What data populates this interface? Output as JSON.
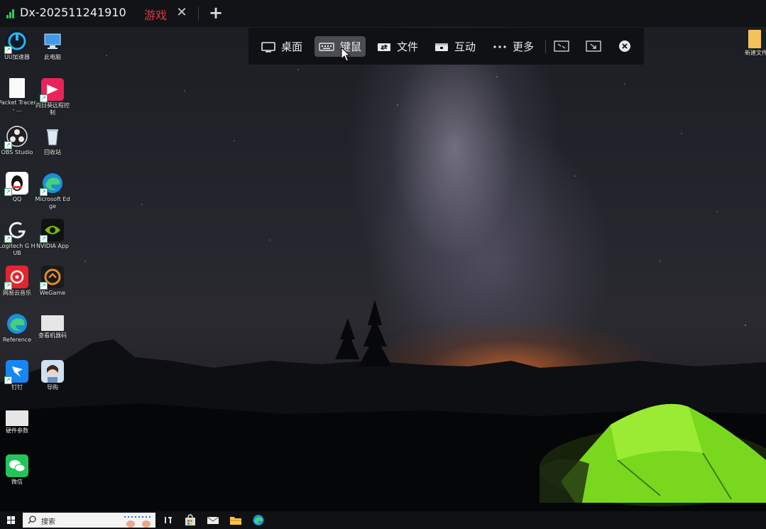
{
  "tabbar": {
    "session_title": "Dx-202511241910",
    "game_tab": "游戏",
    "close_glyph": "✕",
    "new_tab_glyph": "+"
  },
  "toolbar": {
    "items": [
      {
        "label": "桌面",
        "icon": "desktop-icon"
      },
      {
        "label": "键鼠",
        "icon": "keyboard-mouse-icon",
        "active": true
      },
      {
        "label": "文件",
        "icon": "file-transfer-icon"
      },
      {
        "label": "互动",
        "icon": "interact-icon"
      },
      {
        "label": "更多",
        "icon": "more-dots-icon"
      }
    ],
    "window_buttons": [
      "shrink-icon",
      "minimize-to-corner-icon",
      "close-circle-icon"
    ]
  },
  "desktop": {
    "icons_col1": [
      {
        "label": "UU加速器",
        "icon": "uu-accelerator-icon"
      },
      {
        "label": "Packet Tracer - ...",
        "icon": "document-icon"
      },
      {
        "label": "OBS Studio",
        "icon": "obs-icon"
      },
      {
        "label": "QQ",
        "icon": "qq-icon"
      },
      {
        "label": "Logitech G HUB",
        "icon": "logitech-icon"
      },
      {
        "label": "网易云音乐",
        "icon": "netease-music-icon"
      },
      {
        "label": "Reference",
        "icon": "edge-icon"
      },
      {
        "label": "钉钉",
        "icon": "dingtalk-icon"
      },
      {
        "label": "硬件参数",
        "icon": "hardware-icon"
      },
      {
        "label": "微信",
        "icon": "wechat-icon"
      }
    ],
    "icons_col2": [
      {
        "label": "此电脑",
        "icon": "computer-icon"
      },
      {
        "label": "向日葵远程控制",
        "icon": "sunflower-remote-icon"
      },
      {
        "label": "回收站",
        "icon": "recycle-bin-icon"
      },
      {
        "label": "Microsoft Edge",
        "icon": "edge-icon"
      },
      {
        "label": "NVIDIA App",
        "icon": "nvidia-icon"
      },
      {
        "label": "WeGame",
        "icon": "wegame-icon"
      },
      {
        "label": "查看机器码",
        "icon": "machine-code-icon"
      },
      {
        "label": "导购",
        "icon": "avatar-icon"
      }
    ],
    "right_icon": {
      "label": "新建文件",
      "icon": "folder-icon"
    }
  },
  "taskbar": {
    "search_placeholder": "搜索",
    "apps": [
      "task-view-icon",
      "store-icon",
      "mail-icon",
      "file-explorer-icon",
      "edge-icon"
    ]
  },
  "colors": {
    "accent_red": "#e0364a",
    "signal_green": "#35c759",
    "tent_green": "#7ee021"
  }
}
